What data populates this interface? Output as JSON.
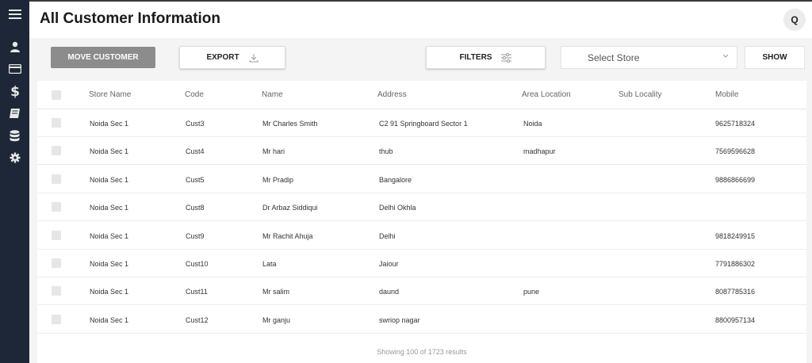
{
  "sidebar": {
    "icons": [
      "menu-icon",
      "user-icon",
      "card-icon",
      "dollar-icon",
      "book-icon",
      "database-icon",
      "gear-icon"
    ]
  },
  "header": {
    "title": "All Customer Information",
    "avatar_initial": "Q"
  },
  "toolbar": {
    "move_label": "MOVE CUSTOMER",
    "export_label": "EXPORT",
    "filters_label": "FILTERS",
    "store_select_value": "Select Store",
    "show_label": "SHOW"
  },
  "table": {
    "columns": [
      "Store Name",
      "Code",
      "Name",
      "Address",
      "Area Location",
      "Sub Locality",
      "Mobile"
    ],
    "rows": [
      [
        "Noida Sec 1",
        "Cust3",
        "Mr Charles Smith",
        "C2 91 Springboard Sector 1",
        "Noida",
        "",
        "9625718324"
      ],
      [
        "Noida Sec 1",
        "Cust4",
        "Mr hari",
        "thub",
        "madhapur",
        "",
        "7569596628"
      ],
      [
        "Noida Sec 1",
        "Cust5",
        "Mr Pradip",
        "Bangalore",
        "",
        "",
        "9886866699"
      ],
      [
        "Noida Sec 1",
        "Cust8",
        "Dr Arbaz Siddiqui",
        "Delhi Okhla",
        "",
        "",
        ""
      ],
      [
        "Noida Sec 1",
        "Cust9",
        "Mr Rachit Ahuja",
        "Delhi",
        "",
        "",
        "9818249915"
      ],
      [
        "Noida Sec 1",
        "Cust10",
        "Lata",
        "Jaiour",
        "",
        "",
        "7791886302"
      ],
      [
        "Noida Sec 1",
        "Cust11",
        "Mr salim",
        "daund",
        "pune",
        "",
        "8087785316"
      ],
      [
        "Noida Sec 1",
        "Cust12",
        "Mr ganju",
        "swriop nagar",
        "",
        "",
        "8800957134"
      ]
    ],
    "footer": "Showing 100 of 1723 results"
  }
}
